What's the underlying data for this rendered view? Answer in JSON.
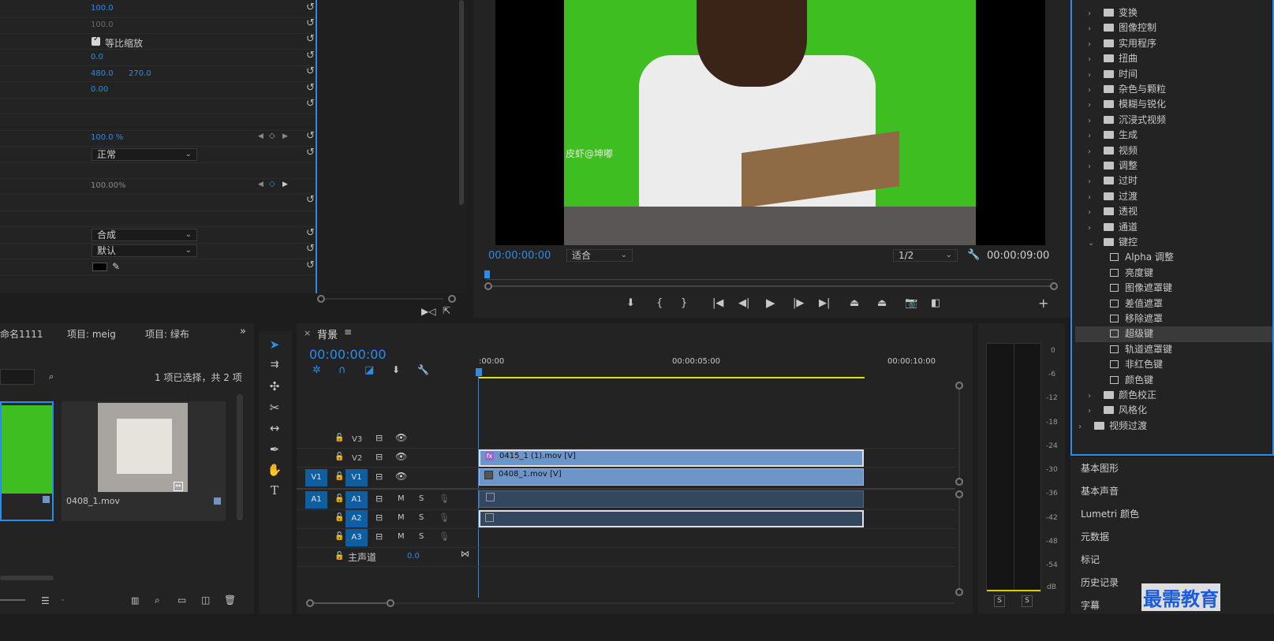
{
  "effect_controls": {
    "values": {
      "scale": "100.0",
      "scale_width": "100.0",
      "uniform_scale": "等比缩放",
      "rotation": "0.0",
      "anchor_x": "480.0",
      "anchor_y": "270.0",
      "anti_flicker": "0.00",
      "opacity": "100.0 %",
      "blend_mode": "正常",
      "time_remap": "100.00%",
      "composite": "合成",
      "default": "默认"
    }
  },
  "program_monitor": {
    "timecode_current": "00:00:00:00",
    "fit": "适合",
    "resolution": "1/2",
    "timecode_duration": "00:00:09:00",
    "watermark": "皮虾@坤嘟"
  },
  "project": {
    "tabs": [
      "命名1111",
      "项目: meig",
      "项目: 绿布"
    ],
    "selection_status": "1 项已选择，共 2 项",
    "items": [
      {
        "label": ""
      },
      {
        "label": "0408_1.mov"
      }
    ]
  },
  "timeline": {
    "tab_title": "背景",
    "timecode": "00:00:00:00",
    "ruler": [
      ":00:00",
      "00:00:05:00",
      "00:00:10:00"
    ],
    "tracks": {
      "v3": "V3",
      "v2": "V2",
      "v1": "V1",
      "a1": "A1",
      "a2": "A2",
      "a3": "A3",
      "source_v1": "V1",
      "source_a1": "A1",
      "mute": "M",
      "solo": "S",
      "master": "主声道",
      "master_value": "0.0"
    },
    "clips": {
      "v2_clip": "0415_1 (1).mov [V]",
      "v1_clip": "0408_1.mov [V]"
    }
  },
  "audio_meter": {
    "labels": [
      "0",
      "-6",
      "-12",
      "-18",
      "-24",
      "-30",
      "-36",
      "-42",
      "-48",
      "-54",
      "dB"
    ],
    "solo_left": "S",
    "solo_right": "S"
  },
  "effects_tree": {
    "folders": [
      "变换",
      "图像控制",
      "实用程序",
      "扭曲",
      "时间",
      "杂色与颗粒",
      "模糊与锐化",
      "沉浸式视频",
      "生成",
      "视频",
      "调整",
      "过时",
      "过渡",
      "透视",
      "通道"
    ],
    "keying_folder": "键控",
    "keying_items": [
      "Alpha 调整",
      "亮度键",
      "图像遮罩键",
      "差值遮罩",
      "移除遮罩",
      "超级键",
      "轨道遮罩键",
      "非红色键",
      "颜色键"
    ],
    "after_folders": [
      "颜色校正",
      "风格化"
    ],
    "video_transitions": "视频过渡"
  },
  "right_panels": [
    "基本图形",
    "基本声音",
    "Lumetri 颜色",
    "元数据",
    "标记",
    "历史记录",
    "字幕"
  ],
  "watermark_brand": "最需教育"
}
